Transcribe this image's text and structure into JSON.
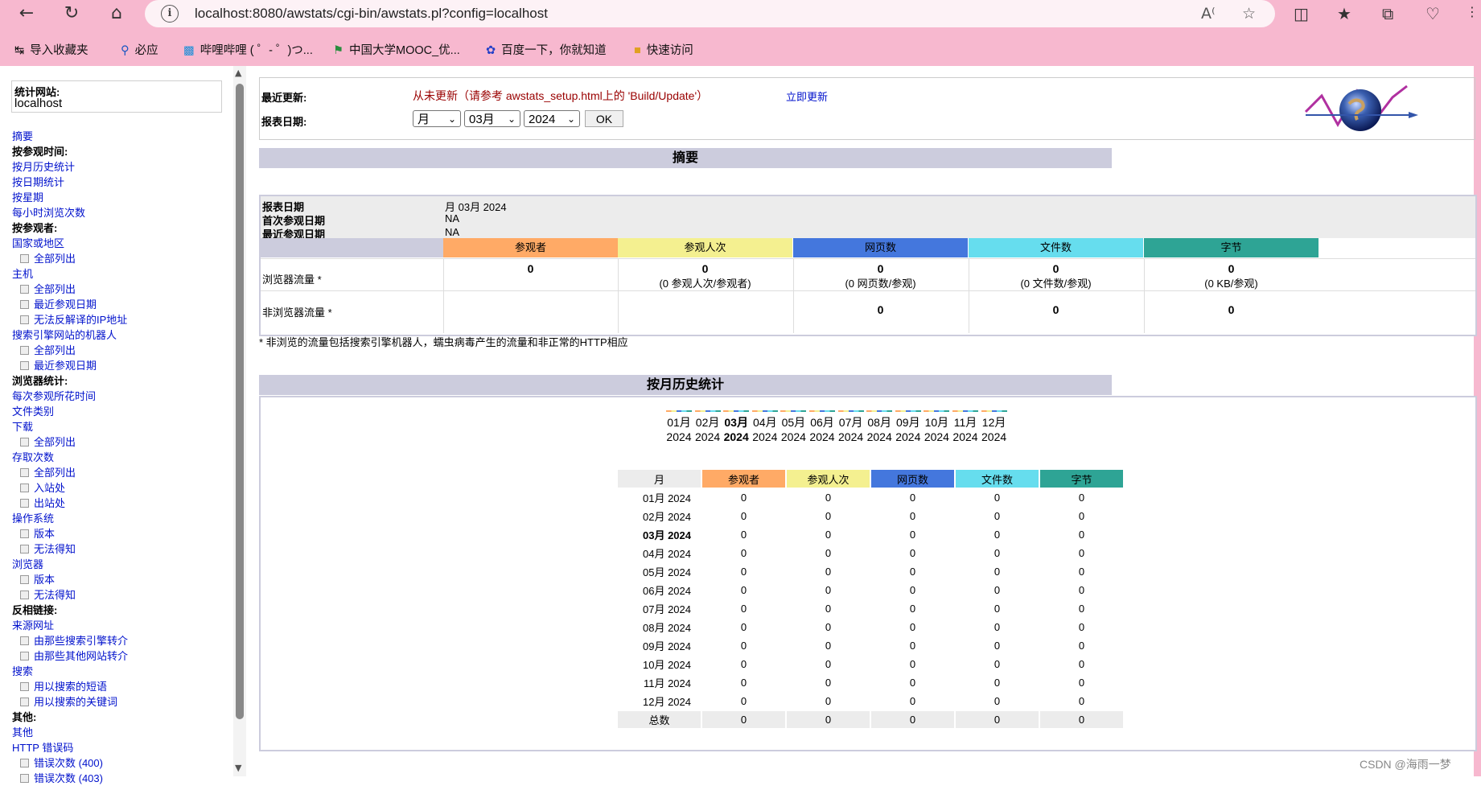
{
  "browser": {
    "url": "localhost:8080/awstats/cgi-bin/awstats.pl?config=localhost",
    "bookmarks": [
      "导入收藏夹",
      "必应",
      "哔哩哔哩 ( ゜- ゜)つ...",
      "中国大学MOOC_优...",
      "百度一下，你就知道",
      "快速访问"
    ],
    "accent_color": "#f7b8cf"
  },
  "sidebar": {
    "site_label": "统计网站:",
    "site_value": "localhost",
    "menu": [
      {
        "text": "摘要",
        "type": "link"
      },
      {
        "text": "按参观时间:",
        "type": "header"
      },
      {
        "text": "按月历史统计",
        "type": "link"
      },
      {
        "text": "按日期统计",
        "type": "link"
      },
      {
        "text": "按星期",
        "type": "link"
      },
      {
        "text": "每小时浏览次数",
        "type": "link"
      },
      {
        "text": "按参观者:",
        "type": "header"
      },
      {
        "text": "国家或地区",
        "type": "link"
      },
      {
        "text": "全部列出",
        "type": "sub"
      },
      {
        "text": "主机",
        "type": "link"
      },
      {
        "text": "全部列出",
        "type": "sub"
      },
      {
        "text": "最近参观日期",
        "type": "sub"
      },
      {
        "text": "无法反解译的IP地址",
        "type": "sub"
      },
      {
        "text": "搜索引擎网站的机器人",
        "type": "link"
      },
      {
        "text": "全部列出",
        "type": "sub"
      },
      {
        "text": "最近参观日期",
        "type": "sub"
      },
      {
        "text": "浏览器统计:",
        "type": "header"
      },
      {
        "text": "每次参观所花时间",
        "type": "link"
      },
      {
        "text": "文件类别",
        "type": "link"
      },
      {
        "text": "下载",
        "type": "link"
      },
      {
        "text": "全部列出",
        "type": "sub"
      },
      {
        "text": "存取次数",
        "type": "link"
      },
      {
        "text": "全部列出",
        "type": "sub"
      },
      {
        "text": "入站处",
        "type": "sub"
      },
      {
        "text": "出站处",
        "type": "sub"
      },
      {
        "text": "操作系统",
        "type": "link"
      },
      {
        "text": "版本",
        "type": "sub"
      },
      {
        "text": "无法得知",
        "type": "sub"
      },
      {
        "text": "浏览器",
        "type": "link"
      },
      {
        "text": "版本",
        "type": "sub"
      },
      {
        "text": "无法得知",
        "type": "sub"
      },
      {
        "text": "反相链接:",
        "type": "header"
      },
      {
        "text": "来源网址",
        "type": "link"
      },
      {
        "text": "由那些搜索引擎转介",
        "type": "sub"
      },
      {
        "text": "由那些其他网站转介",
        "type": "sub"
      },
      {
        "text": "搜索",
        "type": "link"
      },
      {
        "text": "用以搜索的短语",
        "type": "sub"
      },
      {
        "text": "用以搜索的关键词",
        "type": "sub"
      },
      {
        "text": "其他:",
        "type": "header"
      },
      {
        "text": "其他",
        "type": "link"
      },
      {
        "text": "HTTP 错误码",
        "type": "link"
      },
      {
        "text": "错误次数 (400)",
        "type": "sub"
      },
      {
        "text": "错误次数 (403)",
        "type": "sub"
      }
    ]
  },
  "header": {
    "last_update_label": "最近更新:",
    "last_update_value": "从未更新（请参考 awstats_setup.html上的 'Build/Update'）",
    "update_now": "立即更新",
    "report_date_label": "报表日期:",
    "sel_period": "月",
    "sel_month": "03月",
    "sel_year": "2024",
    "ok": "OK"
  },
  "summary": {
    "title": "摘要",
    "rows": [
      {
        "label": "报表日期",
        "value": "月 03月 2024"
      },
      {
        "label": "首次参观日期",
        "value": "NA"
      },
      {
        "label": "最近参观日期",
        "value": "NA"
      }
    ],
    "columns": [
      {
        "name": "参观者",
        "color": "#ffaa66"
      },
      {
        "name": "参观人次",
        "color": "#f4f090"
      },
      {
        "name": "网页数",
        "color": "#4477dd"
      },
      {
        "name": "文件数",
        "color": "#66ddee"
      },
      {
        "name": "字节",
        "color": "#2ea495"
      }
    ],
    "browser_traffic_label": "浏览器流量 *",
    "browser_values": [
      "0",
      "0",
      "0",
      "0",
      "0"
    ],
    "browser_sub": [
      "",
      "(0 参观人次/参观者)",
      "(0 网页数/参观)",
      "(0 文件数/参观)",
      "(0 KB/参观)"
    ],
    "nonbrowser_label": "非浏览器流量 *",
    "nonbrowser_values": [
      "",
      "",
      "0",
      "0",
      "0"
    ],
    "note": "* 非浏览的流量包括搜索引擎机器人，蠕虫病毒产生的流量和非正常的HTTP相应"
  },
  "monthly": {
    "title": "按月历史统计",
    "months": [
      "01月",
      "02月",
      "03月",
      "04月",
      "05月",
      "06月",
      "07月",
      "08月",
      "09月",
      "10月",
      "11月",
      "12月"
    ],
    "year": "2024",
    "current_index": 2,
    "col_month": "月",
    "rows": [
      {
        "month": "01月 2024",
        "v": [
          "0",
          "0",
          "0",
          "0",
          "0"
        ]
      },
      {
        "month": "02月 2024",
        "v": [
          "0",
          "0",
          "0",
          "0",
          "0"
        ]
      },
      {
        "month": "03月 2024",
        "v": [
          "0",
          "0",
          "0",
          "0",
          "0"
        ]
      },
      {
        "month": "04月 2024",
        "v": [
          "0",
          "0",
          "0",
          "0",
          "0"
        ]
      },
      {
        "month": "05月 2024",
        "v": [
          "0",
          "0",
          "0",
          "0",
          "0"
        ]
      },
      {
        "month": "06月 2024",
        "v": [
          "0",
          "0",
          "0",
          "0",
          "0"
        ]
      },
      {
        "month": "07月 2024",
        "v": [
          "0",
          "0",
          "0",
          "0",
          "0"
        ]
      },
      {
        "month": "08月 2024",
        "v": [
          "0",
          "0",
          "0",
          "0",
          "0"
        ]
      },
      {
        "month": "09月 2024",
        "v": [
          "0",
          "0",
          "0",
          "0",
          "0"
        ]
      },
      {
        "month": "10月 2024",
        "v": [
          "0",
          "0",
          "0",
          "0",
          "0"
        ]
      },
      {
        "month": "11月 2024",
        "v": [
          "0",
          "0",
          "0",
          "0",
          "0"
        ]
      },
      {
        "month": "12月 2024",
        "v": [
          "0",
          "0",
          "0",
          "0",
          "0"
        ]
      }
    ],
    "total_label": "总数",
    "total": [
      "0",
      "0",
      "0",
      "0",
      "0"
    ]
  },
  "watermark": "CSDN @海雨一梦"
}
